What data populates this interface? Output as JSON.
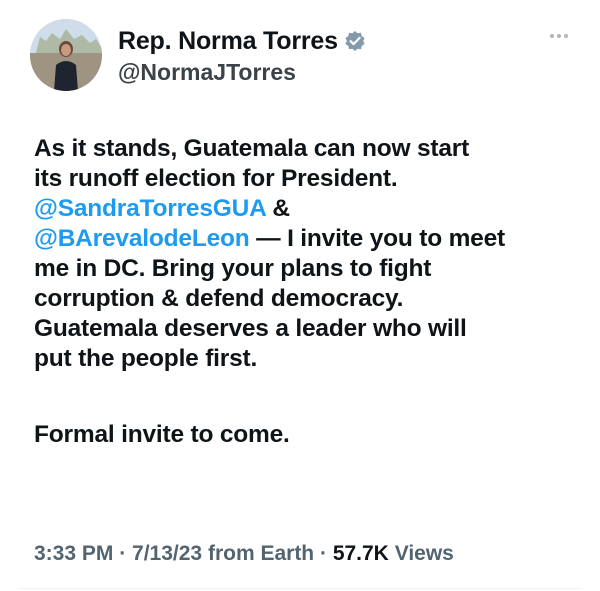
{
  "header": {
    "display_name": "Rep. Norma Torres",
    "handle": "@NormaJTorres",
    "verified_icon": "verified-badge-icon",
    "colors": {
      "verified": "#829aab",
      "link": "#1d9bf0",
      "text": "#0f1419",
      "muted": "#536471"
    }
  },
  "tweet": {
    "line1": "As it stands, Guatemala can now start",
    "line2": "its runoff election for President.",
    "mention1": "@SandraTorresGUA",
    "amp": " &",
    "mention2": "@BArevalodeLeon",
    "line4_rest": " — I invite you to meet",
    "line5": "me in DC. Bring your plans to fight",
    "line6": "corruption & defend democracy.",
    "line7": "Guatemala deserves a leader who will",
    "line8": "put the people first.",
    "line9": "Formal invite to come."
  },
  "meta": {
    "time": "3:33 PM",
    "sep1": " · ",
    "date": "7/13/23",
    "source": " from Earth",
    "sep2": " · ",
    "views_count": "57.7K",
    "views_label": " Views"
  }
}
